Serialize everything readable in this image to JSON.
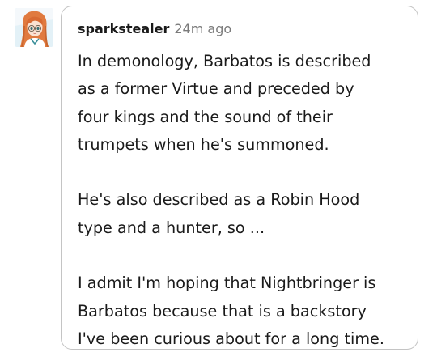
{
  "comment": {
    "username": "sparkstealer",
    "timestamp": "24m ago",
    "paragraphs": [
      [
        "In demonology, Barbatos is described",
        "as a former Virtue and preceded by",
        "four kings and the sound of their",
        "trumpets when he's summoned."
      ],
      [
        "He's also described as a Robin Hood",
        "type and a hunter, so ..."
      ],
      [
        "I admit I'm hoping that Nightbringer is",
        "Barbatos because that is a backstory",
        "I've been curious about for a long time."
      ]
    ]
  },
  "colors": {
    "border": "#c4c4c4",
    "username": "#1a1a1a",
    "timestamp": "#7a7a7a",
    "text": "#1a1a1a",
    "avatar_hair": "#e07a3f",
    "avatar_bg": "#e3f1f7"
  },
  "icons": {
    "avatar": "anime-girl-avatar"
  }
}
